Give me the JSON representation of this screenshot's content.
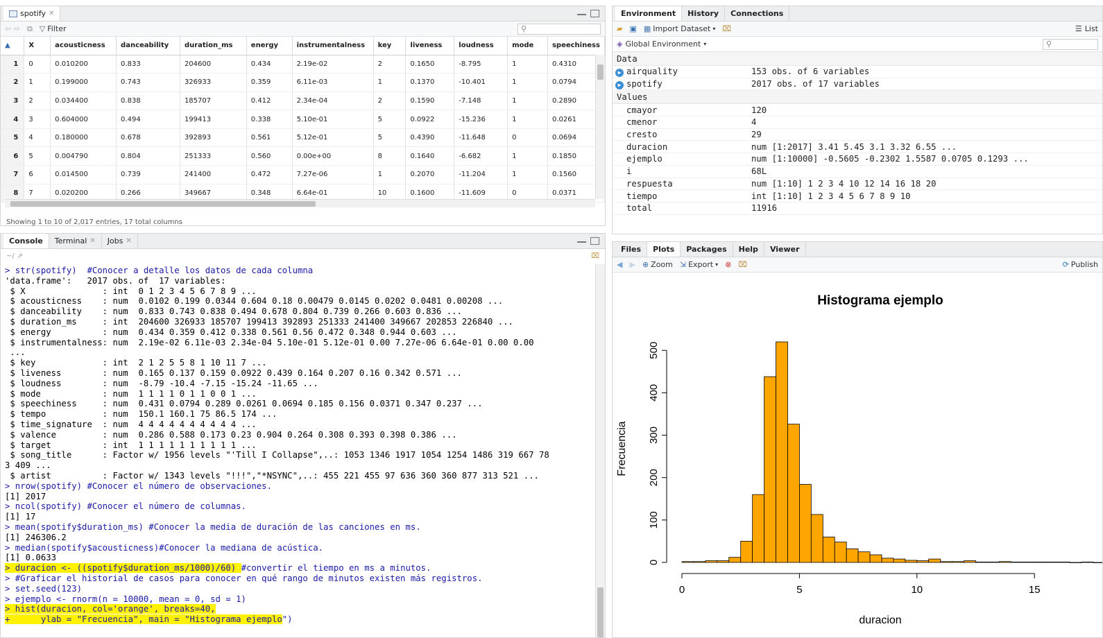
{
  "source_pane": {
    "tab_label": "spotify",
    "filter_label": "Filter",
    "columns": [
      "X",
      "acousticness",
      "danceability",
      "duration_ms",
      "energy",
      "instrumentalness",
      "key",
      "liveness",
      "loudness",
      "mode",
      "speechiness"
    ],
    "rows": [
      [
        "1",
        "0",
        "0.010200",
        "0.833",
        "204600",
        "0.434",
        "2.19e-02",
        "2",
        "0.1650",
        "-8.795",
        "1",
        "0.4310"
      ],
      [
        "2",
        "1",
        "0.199000",
        "0.743",
        "326933",
        "0.359",
        "6.11e-03",
        "1",
        "0.1370",
        "-10.401",
        "1",
        "0.0794"
      ],
      [
        "3",
        "2",
        "0.034400",
        "0.838",
        "185707",
        "0.412",
        "2.34e-04",
        "2",
        "0.1590",
        "-7.148",
        "1",
        "0.2890"
      ],
      [
        "4",
        "3",
        "0.604000",
        "0.494",
        "199413",
        "0.338",
        "5.10e-01",
        "5",
        "0.0922",
        "-15.236",
        "1",
        "0.0261"
      ],
      [
        "5",
        "4",
        "0.180000",
        "0.678",
        "392893",
        "0.561",
        "5.12e-01",
        "5",
        "0.4390",
        "-11.648",
        "0",
        "0.0694"
      ],
      [
        "6",
        "5",
        "0.004790",
        "0.804",
        "251333",
        "0.560",
        "0.00e+00",
        "8",
        "0.1640",
        "-6.682",
        "1",
        "0.1850"
      ],
      [
        "7",
        "6",
        "0.014500",
        "0.739",
        "241400",
        "0.472",
        "7.27e-06",
        "1",
        "0.2070",
        "-11.204",
        "1",
        "0.1560"
      ],
      [
        "8",
        "7",
        "0.020200",
        "0.266",
        "349667",
        "0.348",
        "6.64e-01",
        "10",
        "0.1600",
        "-11.609",
        "0",
        "0.0371"
      ]
    ],
    "status": "Showing 1 to 10 of 2,017 entries, 17 total columns"
  },
  "console_pane": {
    "tabs": [
      {
        "label": "Console"
      },
      {
        "label": "Terminal"
      },
      {
        "label": "Jobs"
      }
    ],
    "path": "~/",
    "lines": [
      {
        "t": "> str(spotify)  #Conocer a detalle los datos de cada columna",
        "cmd": true
      },
      {
        "t": "'data.frame':\t2017 obs. of  17 variables:"
      },
      {
        "t": " $ X               : int  0 1 2 3 4 5 6 7 8 9 ..."
      },
      {
        "t": " $ acousticness    : num  0.0102 0.199 0.0344 0.604 0.18 0.00479 0.0145 0.0202 0.0481 0.00208 ..."
      },
      {
        "t": " $ danceability    : num  0.833 0.743 0.838 0.494 0.678 0.804 0.739 0.266 0.603 0.836 ..."
      },
      {
        "t": " $ duration_ms     : int  204600 326933 185707 199413 392893 251333 241400 349667 202853 226840 ..."
      },
      {
        "t": " $ energy          : num  0.434 0.359 0.412 0.338 0.561 0.56 0.472 0.348 0.944 0.603 ..."
      },
      {
        "t": " $ instrumentalness: num  2.19e-02 6.11e-03 2.34e-04 5.10e-01 5.12e-01 0.00 7.27e-06 6.64e-01 0.00 0.00"
      },
      {
        "t": " ..."
      },
      {
        "t": " $ key             : int  2 1 2 5 5 8 1 10 11 7 ..."
      },
      {
        "t": " $ liveness        : num  0.165 0.137 0.159 0.0922 0.439 0.164 0.207 0.16 0.342 0.571 ..."
      },
      {
        "t": " $ loudness        : num  -8.79 -10.4 -7.15 -15.24 -11.65 ..."
      },
      {
        "t": " $ mode            : num  1 1 1 1 0 1 1 0 0 1 ..."
      },
      {
        "t": " $ speechiness     : num  0.431 0.0794 0.289 0.0261 0.0694 0.185 0.156 0.0371 0.347 0.237 ..."
      },
      {
        "t": " $ tempo           : num  150.1 160.1 75 86.5 174 ..."
      },
      {
        "t": " $ time_signature  : num  4 4 4 4 4 4 4 4 4 4 ..."
      },
      {
        "t": " $ valence         : num  0.286 0.588 0.173 0.23 0.904 0.264 0.308 0.393 0.398 0.386 ..."
      },
      {
        "t": " $ target          : int  1 1 1 1 1 1 1 1 1 1 ..."
      },
      {
        "t": " $ song_title      : Factor w/ 1956 levels \"'Till I Collapse\",..: 1053 1346 1917 1054 1254 1486 319 667 78"
      },
      {
        "t": "3 409 ..."
      },
      {
        "t": " $ artist          : Factor w/ 1343 levels \"!!!\",\"*NSYNC\",..: 455 221 455 97 636 360 360 877 313 521 ..."
      },
      {
        "t": "> nrow(spotify) #Conocer el número de observaciones.",
        "cmd": true
      },
      {
        "t": "[1] 2017"
      },
      {
        "t": "> ncol(spotify) #Conocer el número de columnas.",
        "cmd": true
      },
      {
        "t": "[1] 17"
      },
      {
        "t": "> mean(spotify$duration_ms) #Conocer la media de duración de las canciones en ms.",
        "cmd": true
      },
      {
        "t": "[1] 246306.2"
      },
      {
        "t": "> median(spotify$acousticness)#Conocer la mediana de acústica.",
        "cmd": true
      },
      {
        "t": "[1] 0.0633"
      },
      {
        "t": "> duracion <- ((spotify$duration_ms/1000)/60) #convertir el tiempo en ms a minutos.",
        "cmd": true,
        "hl": 46
      },
      {
        "t": "> #Graficar el historial de casos para conocer en qué rango de minutos existen más registros.",
        "cmd": true
      },
      {
        "t": "> set.seed(123)",
        "cmd": true
      },
      {
        "t": "> ejemplo <- rnorm(n = 10000, mean = 0, sd = 1)",
        "cmd": true
      },
      {
        "t": "> hist(duracion, col='orange', breaks=40,",
        "cmd": true,
        "hl": 42
      },
      {
        "t": "+      ylab = \"Frecuencia\", main = \"Histograma ejemplo\")",
        "cmd": true,
        "hl": 54
      }
    ]
  },
  "env_pane": {
    "tabs": [
      {
        "label": "Environment"
      },
      {
        "label": "History"
      },
      {
        "label": "Connections"
      }
    ],
    "import_label": "Import Dataset",
    "list_label": "List",
    "scope_label": "Global Environment",
    "data_header": "Data",
    "data": [
      {
        "name": "airquality",
        "value": "153 obs. of 6 variables"
      },
      {
        "name": "spotify",
        "value": "2017 obs. of 17 variables"
      }
    ],
    "values_header": "Values",
    "values": [
      {
        "name": "cmayor",
        "value": "120"
      },
      {
        "name": "cmenor",
        "value": "4"
      },
      {
        "name": "cresto",
        "value": "29"
      },
      {
        "name": "duracion",
        "value": "num [1:2017] 3.41 5.45 3.1 3.32 6.55 ..."
      },
      {
        "name": "ejemplo",
        "value": "num [1:10000] -0.5605 -0.2302 1.5587 0.0705 0.1293 ..."
      },
      {
        "name": "i",
        "value": "68L"
      },
      {
        "name": "respuesta",
        "value": "num [1:10] 1 2 3 4 10 12 14 16 18 20"
      },
      {
        "name": "tiempo",
        "value": "int [1:10] 1 2 3 4 5 6 7 8 9 10"
      },
      {
        "name": "total",
        "value": "11916"
      }
    ]
  },
  "plots_pane": {
    "tabs": [
      {
        "label": "Files"
      },
      {
        "label": "Plots"
      },
      {
        "label": "Packages"
      },
      {
        "label": "Help"
      },
      {
        "label": "Viewer"
      }
    ],
    "zoom_label": "Zoom",
    "export_label": "Export",
    "publish_label": "Publish"
  },
  "chart_data": {
    "type": "bar",
    "title": "Histograma ejemplo",
    "xlabel": "duracion",
    "ylabel": "Frecuencia",
    "bar_color": "#ffa500",
    "bin_width": 0.5,
    "bin_start": 0,
    "values": [
      2,
      2,
      4,
      4,
      12,
      50,
      160,
      438,
      520,
      326,
      184,
      113,
      60,
      48,
      32,
      25,
      18,
      10,
      8,
      5,
      4,
      8,
      2,
      2,
      4,
      1,
      1,
      2,
      1,
      1,
      1,
      1,
      1,
      0,
      1,
      0,
      1,
      0,
      1,
      1,
      1,
      1
    ],
    "xticks": [
      0,
      5,
      10,
      15
    ],
    "yticks": [
      0,
      100,
      200,
      300,
      400,
      500
    ],
    "xlim": [
      0,
      17
    ],
    "ylim": [
      0,
      520
    ]
  },
  "colors": {
    "highlight": "#fff200",
    "command": "#1a1aa6",
    "accent": "#2a7ab0"
  }
}
